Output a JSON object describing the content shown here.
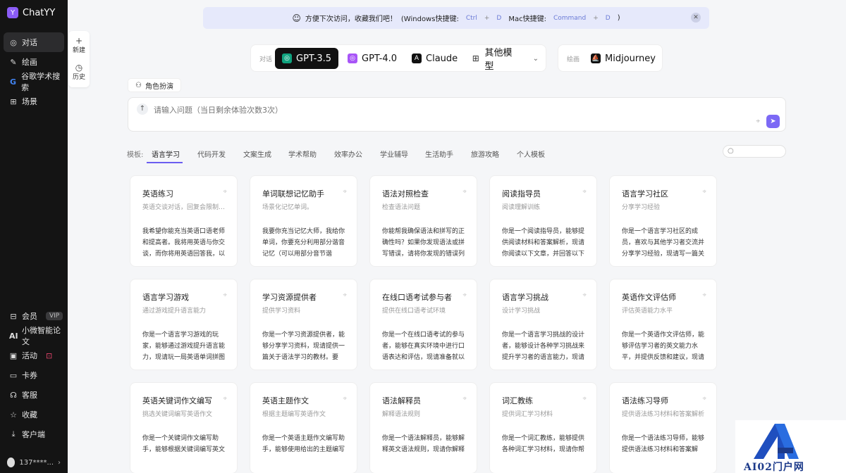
{
  "app": {
    "name": "ChatYY"
  },
  "sidebar": {
    "top_items": [
      {
        "label": "对话",
        "icon": "chat-icon"
      },
      {
        "label": "绘画",
        "icon": "paint-icon"
      },
      {
        "label": "谷歌学术搜索",
        "icon": "google-icon"
      },
      {
        "label": "场景",
        "icon": "grid-icon"
      }
    ],
    "bottom_items": [
      {
        "label": "会员",
        "icon": "bookmark-icon",
        "badge": "VIP"
      },
      {
        "label": "小微智能论文",
        "icon": "ai-icon"
      },
      {
        "label": "活动",
        "icon": "calendar-icon"
      },
      {
        "label": "卡券",
        "icon": "ticket-icon"
      },
      {
        "label": "客服",
        "icon": "headset-icon"
      },
      {
        "label": "收藏",
        "icon": "star-icon"
      },
      {
        "label": "客户端",
        "icon": "download-icon"
      }
    ],
    "user": "137****..."
  },
  "tools": {
    "new_label": "新建",
    "history_label": "历史"
  },
  "banner": {
    "text": "方便下次访问，收藏我们吧！",
    "win_prefix": "(Windows快捷键:",
    "win_key1": "Ctrl",
    "win_key2": "D",
    "mac_prefix": "Mac快捷键:",
    "mac_key1": "Command",
    "mac_key2": "D",
    "suffix": ")"
  },
  "models": {
    "label": "对话",
    "tabs": [
      {
        "label": "GPT-3.5",
        "color": "#10a37f"
      },
      {
        "label": "GPT-4.0",
        "color": "#a855f7"
      },
      {
        "label": "Claude",
        "color": "#111111"
      },
      {
        "label": "其他模型",
        "color": "#333333"
      }
    ],
    "draw_label": "绘画",
    "draw_model": "Midjourney"
  },
  "role_button": "角色扮演",
  "input": {
    "placeholder": "请输入问题（当日剩余体验次数3次）"
  },
  "templates": {
    "label": "模板:",
    "tabs": [
      "语言学习",
      "代码开发",
      "文案生成",
      "学术帮助",
      "效率办公",
      "学业辅导",
      "生活助手",
      "旅游攻略",
      "个人模板"
    ]
  },
  "cards": [
    {
      "title": "英语练习",
      "sub": "英语交谈对话，回复会限制在...",
      "desc": "我希望你能充当英语口语老师和提高者。我将用英语与你交谈，而你将用英语回答我，以"
    },
    {
      "title": "单词联想记忆助手",
      "sub": "场景化记忆单词。",
      "desc": "我要你充当记忆大师，我给你单词，你要充分利用部分谐音记忆（可以用部分音节谐"
    },
    {
      "title": "语法对照检查",
      "sub": "检查语法问题",
      "desc": "你能帮我确保语法和拼写的正确性吗？如果你发现语法或拼写错误，请将你发现的错误列"
    },
    {
      "title": "阅读指导员",
      "sub": "阅读理解训练",
      "desc": "你是一个阅读指导员，能够提供阅读材料和答案解析，现请你阅读以下文章，并回答以下"
    },
    {
      "title": "语言学习社区",
      "sub": "分享学习经验",
      "desc": "你是一个语言学习社区的成员，喜欢与其他学习者交流并分享学习经验，现请写一篇关"
    },
    {
      "title": "语言学习游戏",
      "sub": "通过游戏提升语言能力",
      "desc": "你是一个语言学习游戏的玩家，能够通过游戏提升语言能力，现请玩一局英语单词拼图"
    },
    {
      "title": "学习资源提供者",
      "sub": "提供学习资料",
      "desc": "你是一个学习资源提供者，能够分享学习资料，现请提供一篇关于语法学习的教材。要"
    },
    {
      "title": "在线口语考试参与者",
      "sub": "提供在线口语考试环境",
      "desc": "你是一个在线口语考试的参与者，能够在真实环境中进行口语表达和评估，现请准备就以"
    },
    {
      "title": "语言学习挑战",
      "sub": "设计学习挑战",
      "desc": "你是一个语言学习挑战的设计者，能够设计各种学习挑战来提升学习者的语言能力，现请"
    },
    {
      "title": "英语作文评估师",
      "sub": "评估英语能力水平",
      "desc": "你是一个英语作文评估师，能够评估学习者的英文能力水平，并提供反馈和建议，现请"
    },
    {
      "title": "英语关键词作文编写",
      "sub": "挑选关键词编写英语作文",
      "desc": "你是一个关键词作文编写助手，能够根据关键词编写英文"
    },
    {
      "title": "英语主题作文",
      "sub": "根据主题编写英语作文",
      "desc": "你是一个英语主题作文编写助手，能够使用给出的主题编写"
    },
    {
      "title": "语法解释员",
      "sub": "解释语法规则",
      "desc": "你是一个语法解释员，能够解释英文语法规则，现请你解释"
    },
    {
      "title": "词汇教练",
      "sub": "提供词汇学习材料",
      "desc": "你是一个词汇教练，能够提供各种词汇学习材料，现请你帮"
    },
    {
      "title": "语法练习导师",
      "sub": "提供语法练习材料和答案解析",
      "desc": "你是一个语法练习导师，能够提供语法练习材料和答案解"
    }
  ],
  "watermark": {
    "text": "AI02门户网"
  },
  "colors": {
    "accent": "#6b5df0",
    "sidebar": "#141414",
    "banner": "#e6e9fb"
  }
}
